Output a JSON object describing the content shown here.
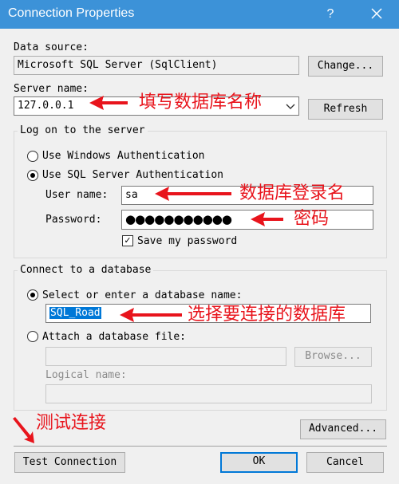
{
  "window": {
    "title": "Connection Properties",
    "help_glyph": "?"
  },
  "data_source": {
    "label": "Data source:",
    "value": "Microsoft SQL Server (SqlClient)",
    "change_label": "Change..."
  },
  "server": {
    "label": "Server name:",
    "value": "127.0.0.1",
    "refresh_label": "Refresh"
  },
  "logon": {
    "legend": "Log on to the server",
    "windows_auth_label": "Use Windows Authentication",
    "sql_auth_label": "Use SQL Server Authentication",
    "username_label": "User name:",
    "username_value": "sa",
    "password_label": "Password:",
    "password_mask": "●●●●●●●●●●●",
    "save_password_label": "Save my password",
    "save_password_checked": true
  },
  "database": {
    "legend": "Connect to a database",
    "select_label": "Select or enter a database name:",
    "db_name_value": "SQL_Road",
    "attach_label": "Attach a database file:",
    "browse_label": "Browse...",
    "logical_name_label": "Logical name:"
  },
  "buttons": {
    "advanced": "Advanced...",
    "test": "Test Connection",
    "ok": "OK",
    "cancel": "Cancel"
  },
  "annotations": {
    "server": "填写数据库名称",
    "username": "数据库登录名",
    "password": "密码",
    "database": "选择要连接的数据库",
    "test": "测试连接"
  },
  "colors": {
    "titlebar": "#3c92d8",
    "annotation": "#e8141c",
    "selection": "#0078d7"
  }
}
